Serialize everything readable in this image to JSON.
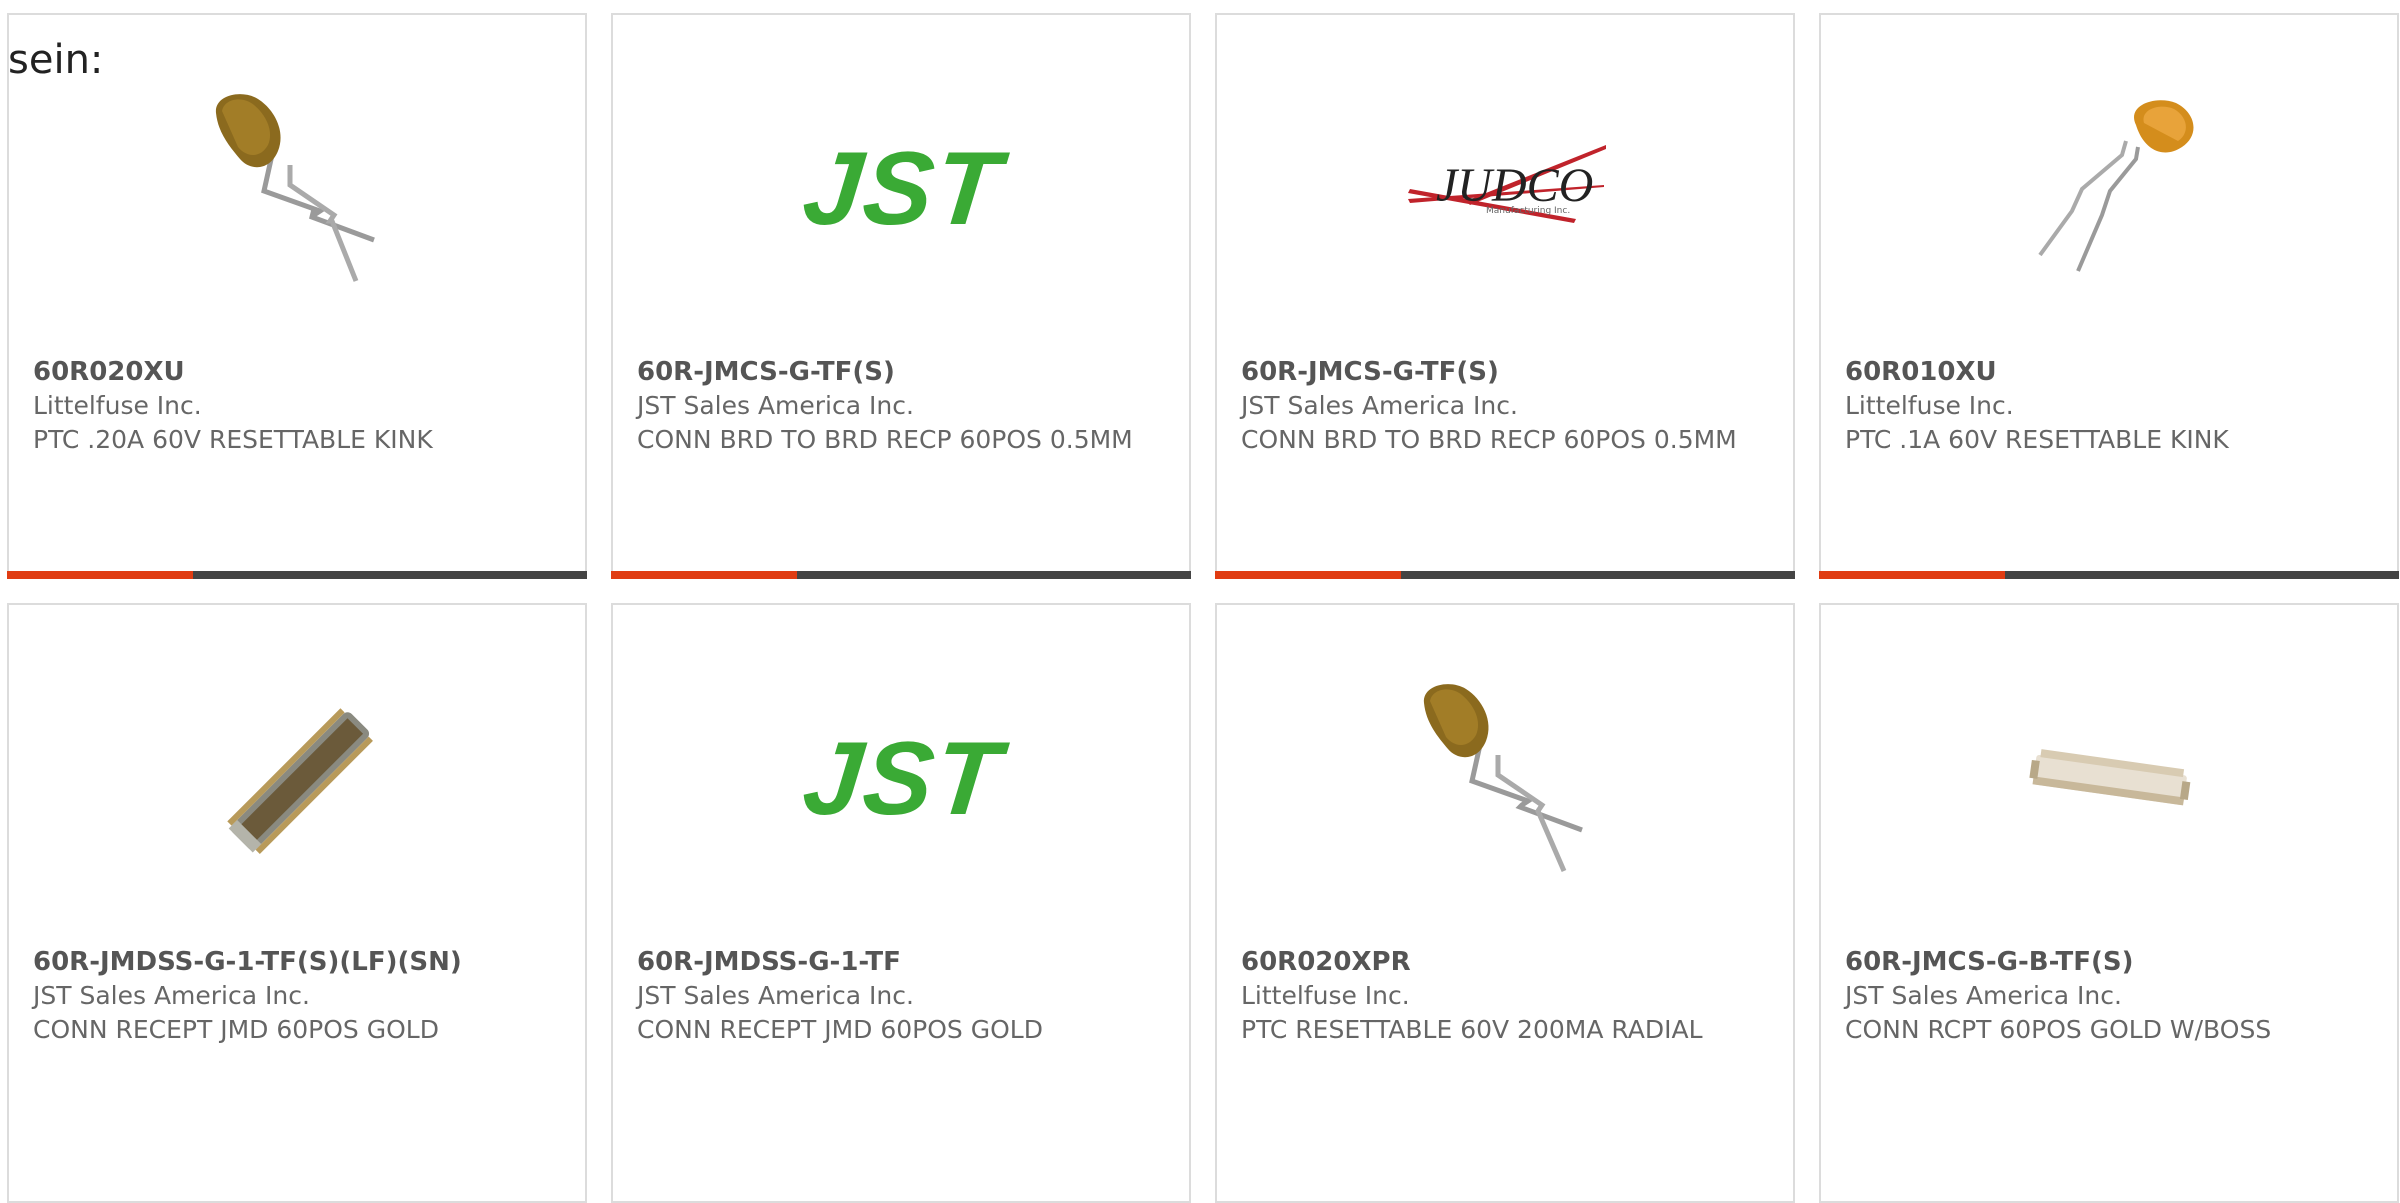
{
  "intro": {
    "text": "sein:"
  },
  "colors": {
    "accent": "#e03c12",
    "bar_track": "#444444",
    "jst_green": "#3aaa35",
    "judco_red": "#c0232b"
  },
  "products": [
    {
      "part_number": "60R020XU",
      "manufacturer": "Littelfuse Inc.",
      "description": "PTC .20A 60V RESETTABLE KINK",
      "image": "ptc-fuse-icon",
      "progress": 0.32
    },
    {
      "part_number": "60R-JMCS-G-TF(S)",
      "manufacturer": "JST Sales America Inc.",
      "description": "CONN BRD TO BRD RECP 60POS 0.5MM",
      "image": "jst-logo",
      "logo_text": "JST",
      "progress": 0.32
    },
    {
      "part_number": "60R-JMCS-G-TF(S)",
      "manufacturer": "JST Sales America Inc.",
      "description": "CONN BRD TO BRD RECP 60POS 0.5MM",
      "image": "judco-logo",
      "logo_text": "JUDCO",
      "logo_subtext": "Manufacturing Inc.",
      "progress": 0.32
    },
    {
      "part_number": "60R010XU",
      "manufacturer": "Littelfuse Inc.",
      "description": "PTC .1A 60V RESETTABLE KINK",
      "image": "ptc-fuse-orange-icon",
      "progress": 0.32
    },
    {
      "part_number": "60R-JMDSS-G-1-TF(S)(LF)(SN)",
      "manufacturer": "JST Sales America Inc.",
      "description": "CONN RECEPT JMD 60POS GOLD",
      "image": "connector-icon"
    },
    {
      "part_number": "60R-JMDSS-G-1-TF",
      "manufacturer": "JST Sales America Inc.",
      "description": "CONN RECEPT JMD 60POS GOLD",
      "image": "jst-logo",
      "logo_text": "JST"
    },
    {
      "part_number": "60R020XPR",
      "manufacturer": "Littelfuse Inc.",
      "description": "PTC RESETTABLE 60V 200MA RADIAL",
      "image": "ptc-fuse-icon"
    },
    {
      "part_number": "60R-JMCS-G-B-TF(S)",
      "manufacturer": "JST Sales America Inc.",
      "description": "CONN RCPT 60POS GOLD W/BOSS",
      "image": "board-connector-icon"
    }
  ]
}
